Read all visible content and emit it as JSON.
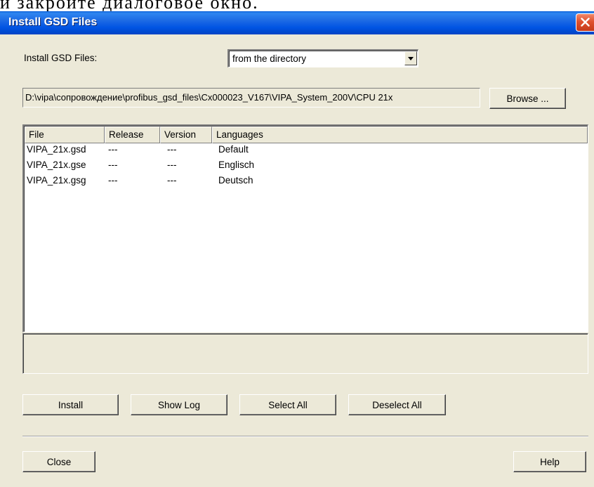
{
  "page_text": "и закройте диалоговое окно.",
  "window": {
    "title": "Install GSD Files"
  },
  "source": {
    "label": "Install GSD Files:",
    "selected": "from the directory"
  },
  "path": {
    "value": "D:\\vipa\\сопровождение\\profibus_gsd_files\\Cx000023_V167\\VIPA_System_200V\\CPU 21x",
    "browse_label": "Browse ..."
  },
  "table": {
    "columns": [
      "File",
      "Release",
      "Version",
      "Languages"
    ],
    "rows": [
      {
        "file": "VIPA_21x.gsd",
        "release": "---",
        "version": "---",
        "languages": "Default"
      },
      {
        "file": "VIPA_21x.gse",
        "release": "---",
        "version": "---",
        "languages": "Englisch"
      },
      {
        "file": "VIPA_21x.gsg",
        "release": "---",
        "version": "---",
        "languages": "Deutsch"
      }
    ]
  },
  "actions": {
    "install": "Install",
    "show_log": "Show Log",
    "select_all": "Select All",
    "deselect_all": "Deselect All"
  },
  "footer": {
    "close": "Close",
    "help": "Help"
  },
  "icons": {
    "close": "close-x-icon",
    "dropdown": "chevron-down-icon"
  },
  "colors": {
    "titlebar": "#0054e3",
    "close_button": "#e0502e",
    "dialog_bg": "#ece9d8"
  }
}
